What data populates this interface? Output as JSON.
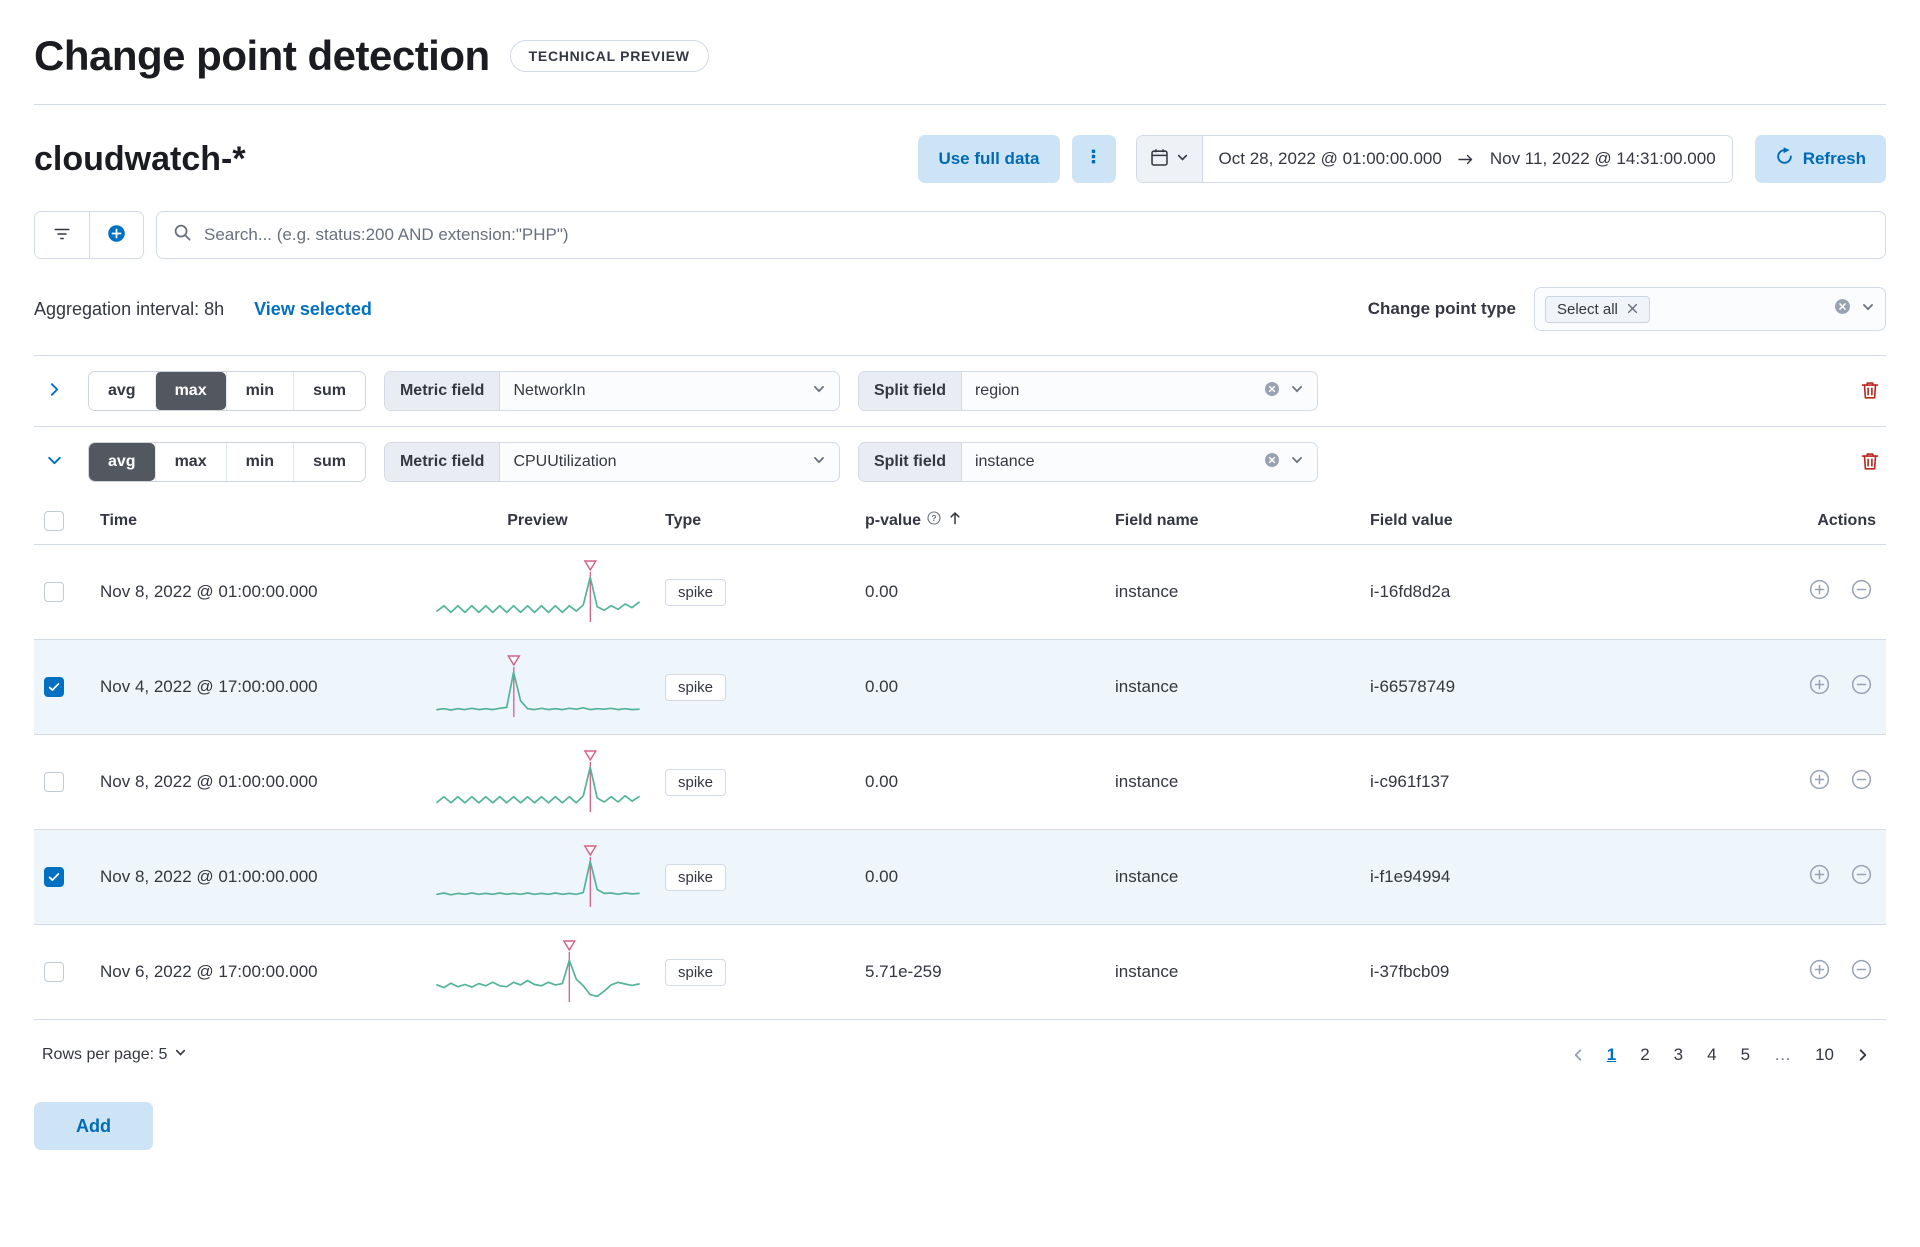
{
  "page": {
    "title": "Change point detection",
    "tech_preview_badge": "TECHNICAL PREVIEW"
  },
  "toolbar": {
    "data_view": "cloudwatch-*",
    "use_full_data_label": "Use full data",
    "date_start": "Oct 28, 2022 @ 01:00:00.000",
    "date_end": "Nov 11, 2022 @ 14:31:00.000",
    "refresh_label": "Refresh"
  },
  "search": {
    "placeholder": "Search... (e.g. status:200 AND extension:\"PHP\")"
  },
  "meta": {
    "aggregation_interval": "Aggregation interval: 8h",
    "view_selected": "View selected",
    "change_point_type_label": "Change point type",
    "change_point_type_selected": "Select all"
  },
  "configs": [
    {
      "fn_options": [
        "avg",
        "max",
        "min",
        "sum"
      ],
      "selected_fn": "max",
      "metric_field_label": "Metric field",
      "metric_field_value": "NetworkIn",
      "split_field_label": "Split field",
      "split_field_value": "region"
    },
    {
      "fn_options": [
        "avg",
        "max",
        "min",
        "sum"
      ],
      "selected_fn": "avg",
      "metric_field_label": "Metric field",
      "metric_field_value": "CPUUtilization",
      "split_field_label": "Split field",
      "split_field_value": "instance"
    }
  ],
  "table": {
    "headers": {
      "time": "Time",
      "preview": "Preview",
      "type": "Type",
      "p_value": "p-value",
      "field_name": "Field name",
      "field_value": "Field value",
      "actions": "Actions"
    },
    "rows": [
      {
        "checked": false,
        "time": "Nov 8, 2022 @ 01:00:00.000",
        "type": "spike",
        "p_value": "0.00",
        "field_name": "instance",
        "field_value": "i-16fd8d2a",
        "marker_frac": 0.759,
        "sparkline": [
          0.18,
          0.3,
          0.15,
          0.3,
          0.15,
          0.3,
          0.15,
          0.3,
          0.15,
          0.3,
          0.15,
          0.3,
          0.15,
          0.3,
          0.15,
          0.3,
          0.15,
          0.3,
          0.15,
          0.3,
          0.18,
          0.32,
          0.95,
          0.28,
          0.2,
          0.3,
          0.22,
          0.34,
          0.26,
          0.38
        ]
      },
      {
        "checked": true,
        "time": "Nov 4, 2022 @ 17:00:00.000",
        "type": "spike",
        "p_value": "0.00",
        "field_name": "instance",
        "field_value": "i-66578749",
        "marker_frac": 0.38,
        "sparkline": [
          0.1,
          0.12,
          0.09,
          0.12,
          0.1,
          0.13,
          0.1,
          0.12,
          0.1,
          0.13,
          0.15,
          0.95,
          0.3,
          0.12,
          0.1,
          0.13,
          0.1,
          0.12,
          0.1,
          0.13,
          0.11,
          0.14,
          0.1,
          0.12,
          0.11,
          0.13,
          0.1,
          0.12,
          0.1,
          0.11
        ]
      },
      {
        "checked": false,
        "time": "Nov 8, 2022 @ 01:00:00.000",
        "type": "spike",
        "p_value": "0.00",
        "field_name": "instance",
        "field_value": "i-c961f137",
        "marker_frac": 0.759,
        "sparkline": [
          0.15,
          0.28,
          0.14,
          0.28,
          0.14,
          0.28,
          0.14,
          0.28,
          0.14,
          0.28,
          0.14,
          0.28,
          0.14,
          0.28,
          0.14,
          0.28,
          0.14,
          0.28,
          0.14,
          0.28,
          0.14,
          0.3,
          0.95,
          0.25,
          0.16,
          0.28,
          0.16,
          0.3,
          0.18,
          0.28
        ]
      },
      {
        "checked": true,
        "time": "Nov 8, 2022 @ 01:00:00.000",
        "type": "spike",
        "p_value": "0.00",
        "field_name": "instance",
        "field_value": "i-f1e94994",
        "marker_frac": 0.759,
        "sparkline": [
          0.22,
          0.25,
          0.21,
          0.24,
          0.22,
          0.25,
          0.22,
          0.24,
          0.22,
          0.25,
          0.22,
          0.24,
          0.22,
          0.25,
          0.22,
          0.24,
          0.22,
          0.25,
          0.22,
          0.24,
          0.22,
          0.26,
          0.97,
          0.33,
          0.24,
          0.25,
          0.22,
          0.25,
          0.23,
          0.24
        ]
      },
      {
        "checked": false,
        "time": "Nov 6, 2022 @ 17:00:00.000",
        "type": "spike",
        "p_value": "5.71e-259",
        "field_name": "instance",
        "field_value": "i-37fbcb09",
        "marker_frac": 0.655,
        "sparkline": [
          0.32,
          0.26,
          0.36,
          0.28,
          0.33,
          0.27,
          0.35,
          0.3,
          0.38,
          0.3,
          0.28,
          0.38,
          0.32,
          0.42,
          0.33,
          0.3,
          0.38,
          0.32,
          0.35,
          0.88,
          0.45,
          0.3,
          0.1,
          0.06,
          0.18,
          0.32,
          0.38,
          0.34,
          0.31,
          0.34
        ]
      }
    ]
  },
  "pagination": {
    "rows_per_page_label": "Rows per page: 5",
    "pages": [
      "1",
      "2",
      "3",
      "4",
      "5",
      "…",
      "10"
    ],
    "current_page": "1"
  },
  "actions": {
    "add_label": "Add"
  },
  "icons": {
    "p_value_info": "?"
  },
  "colors": {
    "accent_blue": "#0071c2",
    "button_blue_bg": "#cce4f5",
    "sparkline_green": "#54b399",
    "marker_pink": "#d36086",
    "selected_row_bg": "#eef5fb",
    "danger_red": "#bd271e"
  }
}
